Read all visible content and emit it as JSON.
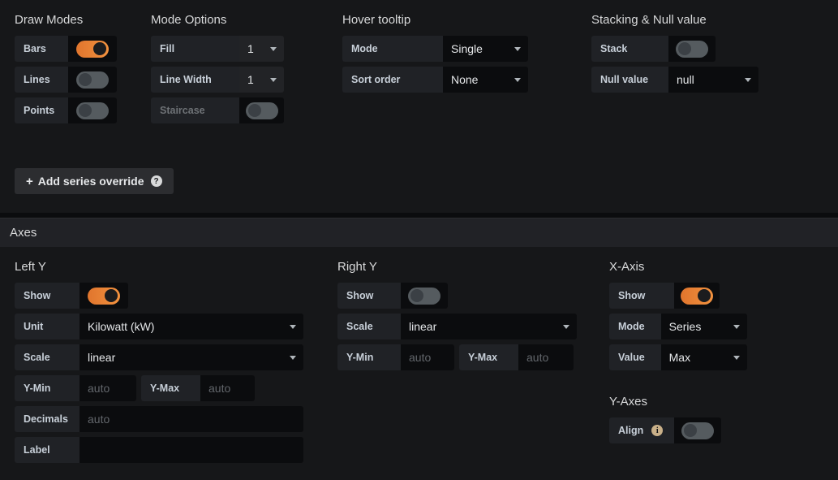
{
  "draw_modes": {
    "title": "Draw Modes",
    "rows": [
      {
        "label": "Bars",
        "state": "on"
      },
      {
        "label": "Lines",
        "state": "off"
      },
      {
        "label": "Points",
        "state": "off"
      }
    ]
  },
  "mode_options": {
    "title": "Mode Options",
    "fill": {
      "label": "Fill",
      "value": "1"
    },
    "line_width": {
      "label": "Line Width",
      "value": "1"
    },
    "staircase": {
      "label": "Staircase",
      "state": "off"
    }
  },
  "hover_tooltip": {
    "title": "Hover tooltip",
    "mode": {
      "label": "Mode",
      "value": "Single"
    },
    "sort_order": {
      "label": "Sort order",
      "value": "None"
    }
  },
  "stacking": {
    "title": "Stacking & Null value",
    "stack": {
      "label": "Stack",
      "state": "off"
    },
    "null_value": {
      "label": "Null value",
      "value": "null"
    }
  },
  "series_override": {
    "label": "Add series override",
    "plus": "+",
    "help_icon": "?"
  },
  "axes_section": {
    "title": "Axes"
  },
  "left_y": {
    "title": "Left Y",
    "show": {
      "label": "Show",
      "state": "on"
    },
    "unit": {
      "label": "Unit",
      "value": "Kilowatt (kW)"
    },
    "scale": {
      "label": "Scale",
      "value": "linear"
    },
    "y_min": {
      "label": "Y-Min",
      "value": "",
      "placeholder": "auto"
    },
    "y_max": {
      "label": "Y-Max",
      "value": "",
      "placeholder": "auto"
    },
    "decimals": {
      "label": "Decimals",
      "value": "",
      "placeholder": "auto"
    },
    "label_field": {
      "label": "Label",
      "value": "",
      "placeholder": ""
    }
  },
  "right_y": {
    "title": "Right Y",
    "show": {
      "label": "Show",
      "state": "off"
    },
    "scale": {
      "label": "Scale",
      "value": "linear"
    },
    "y_min": {
      "label": "Y-Min",
      "value": "",
      "placeholder": "auto"
    },
    "y_max": {
      "label": "Y-Max",
      "value": "",
      "placeholder": "auto"
    }
  },
  "x_axis": {
    "title": "X-Axis",
    "show": {
      "label": "Show",
      "state": "on"
    },
    "mode": {
      "label": "Mode",
      "value": "Series"
    },
    "value": {
      "label": "Value",
      "value": "Max"
    }
  },
  "y_axes": {
    "title": "Y-Axes",
    "align": {
      "label": "Align",
      "state": "off",
      "info_icon": "i"
    }
  },
  "colors": {
    "accent": "#ef843c",
    "panel_bg": "#161719",
    "label_bg": "#202226",
    "value_bg": "#0b0c0e",
    "label_text": "#c8d0d9"
  }
}
